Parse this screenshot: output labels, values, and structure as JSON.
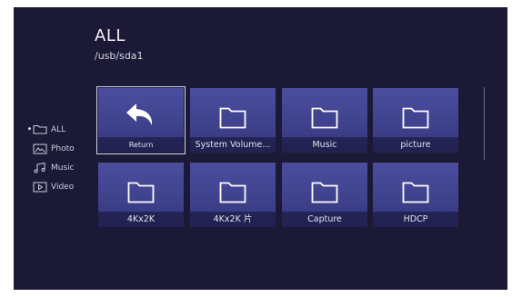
{
  "header": {
    "title": "ALL",
    "path": "/usb/sda1"
  },
  "sidebar": {
    "items": [
      {
        "label": "ALL",
        "icon": "folder-icon",
        "selected": true
      },
      {
        "label": "Photo",
        "icon": "photo-icon",
        "selected": false
      },
      {
        "label": "Music",
        "icon": "music-icon",
        "selected": false
      },
      {
        "label": "Video",
        "icon": "video-icon",
        "selected": false
      }
    ],
    "selected_marker": "•"
  },
  "grid": {
    "tiles": [
      {
        "label": "Return",
        "icon": "return-arrow-icon",
        "selected": true
      },
      {
        "label": "System Volume...",
        "icon": "folder-icon"
      },
      {
        "label": "Music",
        "icon": "folder-icon"
      },
      {
        "label": "picture",
        "icon": "folder-icon"
      },
      {
        "label": "4Kx2K",
        "icon": "folder-icon"
      },
      {
        "label": "4Kx2K 片",
        "icon": "folder-icon"
      },
      {
        "label": "Capture",
        "icon": "folder-icon"
      },
      {
        "label": "HDCP",
        "icon": "folder-icon"
      }
    ]
  },
  "colors": {
    "background": "#1b1935",
    "tile_top": "#4b4e9e",
    "tile_bottom": "#34367a",
    "text": "#e3e3ee"
  }
}
